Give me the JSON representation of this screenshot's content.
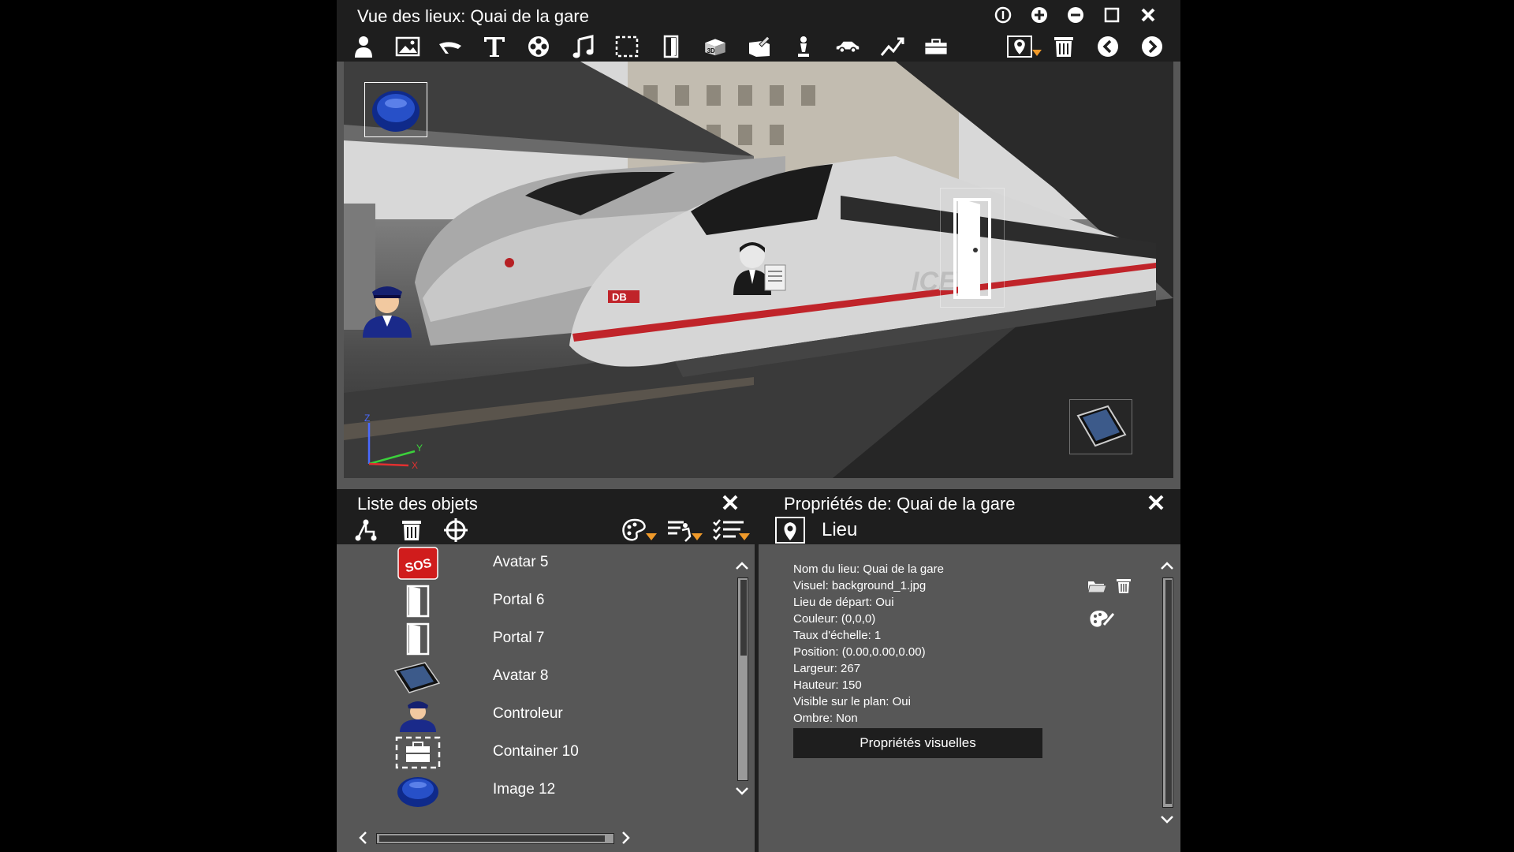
{
  "window": {
    "title": "Vue des lieux: Quai de la gare",
    "controls": [
      "info-icon",
      "plus-icon",
      "minus-icon",
      "maximize-icon",
      "close-icon"
    ]
  },
  "toolbar": {
    "tools": [
      "avatar-icon",
      "image-icon",
      "object-icon",
      "text-icon",
      "film-icon",
      "music-icon",
      "selection-icon",
      "portal-icon",
      "3d-icon",
      "container-icon",
      "marker-icon",
      "car-icon",
      "path-icon",
      "toolbox-icon"
    ],
    "right": [
      "place-menu-icon",
      "delete-icon",
      "previous-icon",
      "next-icon"
    ],
    "label_3d": "3D"
  },
  "scene": {
    "axes": {
      "z": "Z",
      "y": "Y",
      "x": "X"
    },
    "train_text_db": "DB",
    "train_text_ice": "ICE"
  },
  "objects_panel": {
    "title": "Liste des objets",
    "tools": [
      "hierarchy-icon",
      "delete-icon",
      "target-icon",
      "palette-menu-icon",
      "filter-menu-icon",
      "checklist-menu-icon"
    ],
    "items": [
      {
        "label": "Avatar 5",
        "icon": "sos-box-icon"
      },
      {
        "label": "Portal 6",
        "icon": "door-icon"
      },
      {
        "label": "Portal 7",
        "icon": "door-icon"
      },
      {
        "label": "Avatar 8",
        "icon": "smartphone-icon"
      },
      {
        "label": "Controleur",
        "icon": "conductor-icon"
      },
      {
        "label": "Container 10",
        "icon": "briefcase-icon"
      },
      {
        "label": "Image 12",
        "icon": "blue-button-icon"
      }
    ],
    "sos_text": "SOS"
  },
  "properties_panel": {
    "title": "Propriétés de: Quai de la gare",
    "section": "Lieu",
    "lines": [
      "Nom du lieu: Quai de la gare",
      "Visuel: background_1.jpg",
      "Lieu de départ: Oui",
      "Couleur: (0,0,0)",
      "Taux d'échelle: 1",
      "Position: (0.00,0.00,0.00)",
      "Largeur: 267",
      "Hauteur: 150",
      "Visible sur le plan: Oui",
      "Ombre: Non"
    ],
    "button": "Propriétés visuelles"
  },
  "colors": {
    "accent": "#f09a2a",
    "panel": "#575757",
    "bar": "#1e1e1e",
    "rail_red": "#c0242a"
  }
}
